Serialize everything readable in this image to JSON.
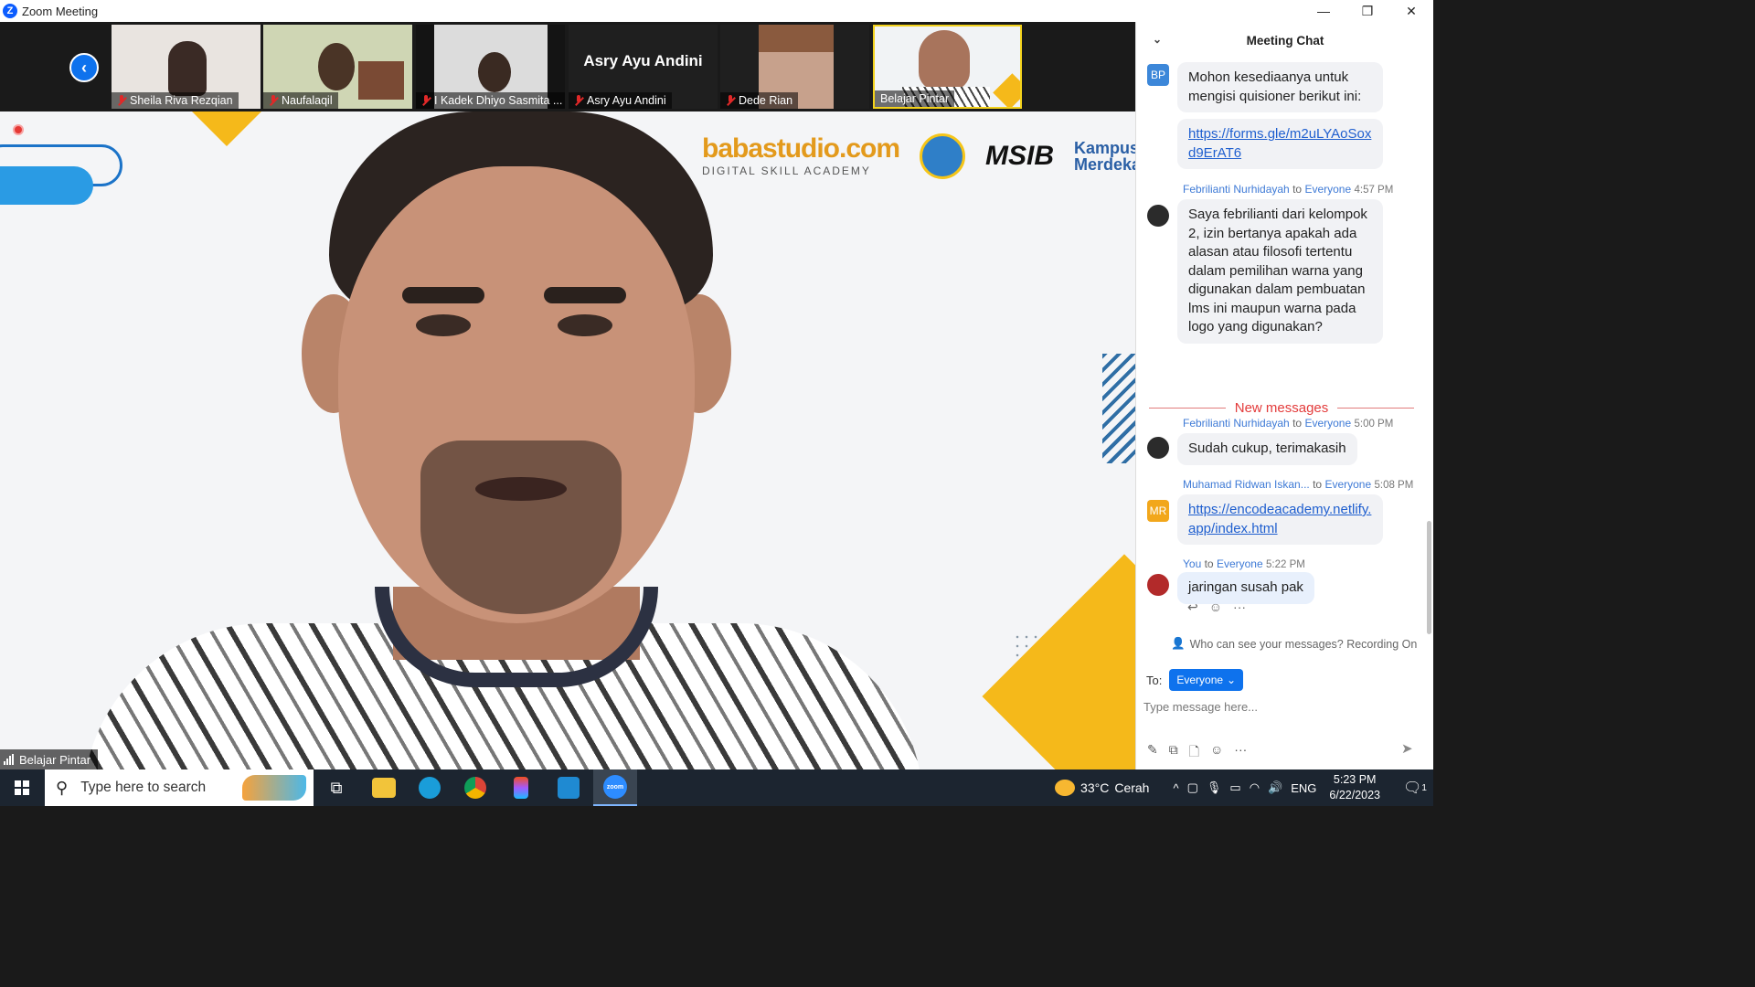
{
  "window": {
    "title": "Zoom Meeting",
    "controls": [
      "—",
      "❐",
      "✕"
    ]
  },
  "participants": [
    {
      "name": "Sheila Riva Rezqian",
      "muted": true
    },
    {
      "name": "Naufalaqil",
      "muted": true
    },
    {
      "name": "I Kadek Dhiyo Sasmita ...",
      "muted": true
    },
    {
      "name": "Asry Ayu Andini",
      "muted": true,
      "video_off": true
    },
    {
      "name": "Dede Rian",
      "muted": true
    },
    {
      "name": "Belajar Pintar",
      "muted": false,
      "active": true
    }
  ],
  "main_video": {
    "speaker": "Belajar Pintar",
    "logos": {
      "baba_line1": "babastudio.com",
      "baba_line2": "DIGITAL SKILL ACADEMY",
      "msib": "MSIB",
      "kampus_merdeka": "Kampus Merdeka"
    },
    "colors": {
      "accent_yellow": "#f5b91a",
      "accent_blue": "#2a9be4"
    }
  },
  "chat": {
    "title": "Meeting Chat",
    "messages": [
      {
        "avatar": "BP",
        "text": "Mohon kesediaanya untuk mengisi quisioner berikut ini:"
      },
      {
        "avatar": "",
        "link": "https://forms.gle/m2uLYAoSoxd9ErAT6"
      },
      {
        "sender": "Febrilianti Nurhidayah",
        "to_word": "to",
        "recipient": "Everyone",
        "time": "4:57 PM",
        "text": "Saya febrilianti dari kelompok 2, izin bertanya apakah ada alasan atau filosofi tertentu dalam pemilihan warna yang digunakan dalam pembuatan lms ini maupun warna pada logo yang digunakan?"
      },
      {
        "sender": "Febrilianti Nurhidayah",
        "to_word": "to",
        "recipient": "Everyone",
        "time": "5:00 PM",
        "text": "Sudah cukup, terimakasih"
      },
      {
        "avatar": "MR",
        "sender": "Muhamad Ridwan Iskan...",
        "to_word": "to",
        "recipient": "Everyone",
        "time": "5:08 PM",
        "link": "https://encodeacademy.netlify.app/index.html"
      },
      {
        "sender": "You",
        "to_word": "to",
        "recipient": "Everyone",
        "time": "5:22 PM",
        "text": "jaringan susah pak"
      }
    ],
    "new_messages_label": "New messages",
    "visibility_notice": "Who can see your messages? Recording On",
    "to_label": "To:",
    "recipient_button": "Everyone",
    "input_placeholder": "Type message here..."
  },
  "taskbar": {
    "search_placeholder": "Type here to search",
    "apps": [
      "task-view",
      "file-explorer",
      "edge",
      "chrome",
      "figma",
      "vscode",
      "zoom"
    ],
    "weather": {
      "temp": "33°C",
      "condition": "Cerah"
    },
    "language": "ENG",
    "time": "5:23 PM",
    "date": "6/22/2023",
    "notification_count": "1"
  }
}
